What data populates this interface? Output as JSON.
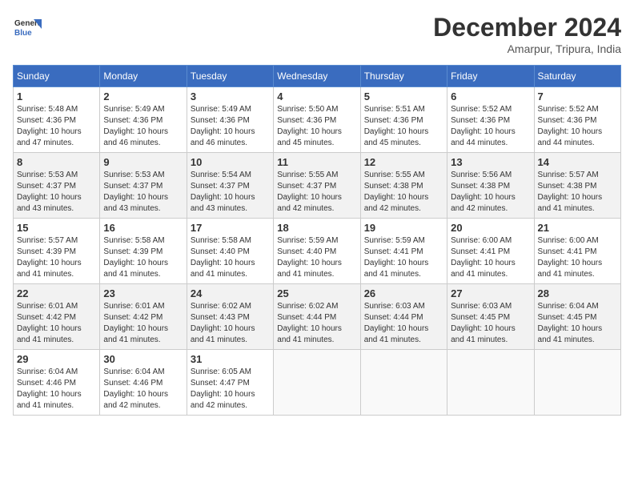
{
  "header": {
    "logo_line1": "General",
    "logo_line2": "Blue",
    "month": "December 2024",
    "location": "Amarpur, Tripura, India"
  },
  "days_of_week": [
    "Sunday",
    "Monday",
    "Tuesday",
    "Wednesday",
    "Thursday",
    "Friday",
    "Saturday"
  ],
  "weeks": [
    [
      {
        "day": "1",
        "sunrise": "5:48 AM",
        "sunset": "4:36 PM",
        "daylight": "10 hours and 47 minutes."
      },
      {
        "day": "2",
        "sunrise": "5:49 AM",
        "sunset": "4:36 PM",
        "daylight": "10 hours and 46 minutes."
      },
      {
        "day": "3",
        "sunrise": "5:49 AM",
        "sunset": "4:36 PM",
        "daylight": "10 hours and 46 minutes."
      },
      {
        "day": "4",
        "sunrise": "5:50 AM",
        "sunset": "4:36 PM",
        "daylight": "10 hours and 45 minutes."
      },
      {
        "day": "5",
        "sunrise": "5:51 AM",
        "sunset": "4:36 PM",
        "daylight": "10 hours and 45 minutes."
      },
      {
        "day": "6",
        "sunrise": "5:52 AM",
        "sunset": "4:36 PM",
        "daylight": "10 hours and 44 minutes."
      },
      {
        "day": "7",
        "sunrise": "5:52 AM",
        "sunset": "4:36 PM",
        "daylight": "10 hours and 44 minutes."
      }
    ],
    [
      {
        "day": "8",
        "sunrise": "5:53 AM",
        "sunset": "4:37 PM",
        "daylight": "10 hours and 43 minutes."
      },
      {
        "day": "9",
        "sunrise": "5:53 AM",
        "sunset": "4:37 PM",
        "daylight": "10 hours and 43 minutes."
      },
      {
        "day": "10",
        "sunrise": "5:54 AM",
        "sunset": "4:37 PM",
        "daylight": "10 hours and 43 minutes."
      },
      {
        "day": "11",
        "sunrise": "5:55 AM",
        "sunset": "4:37 PM",
        "daylight": "10 hours and 42 minutes."
      },
      {
        "day": "12",
        "sunrise": "5:55 AM",
        "sunset": "4:38 PM",
        "daylight": "10 hours and 42 minutes."
      },
      {
        "day": "13",
        "sunrise": "5:56 AM",
        "sunset": "4:38 PM",
        "daylight": "10 hours and 42 minutes."
      },
      {
        "day": "14",
        "sunrise": "5:57 AM",
        "sunset": "4:38 PM",
        "daylight": "10 hours and 41 minutes."
      }
    ],
    [
      {
        "day": "15",
        "sunrise": "5:57 AM",
        "sunset": "4:39 PM",
        "daylight": "10 hours and 41 minutes."
      },
      {
        "day": "16",
        "sunrise": "5:58 AM",
        "sunset": "4:39 PM",
        "daylight": "10 hours and 41 minutes."
      },
      {
        "day": "17",
        "sunrise": "5:58 AM",
        "sunset": "4:40 PM",
        "daylight": "10 hours and 41 minutes."
      },
      {
        "day": "18",
        "sunrise": "5:59 AM",
        "sunset": "4:40 PM",
        "daylight": "10 hours and 41 minutes."
      },
      {
        "day": "19",
        "sunrise": "5:59 AM",
        "sunset": "4:41 PM",
        "daylight": "10 hours and 41 minutes."
      },
      {
        "day": "20",
        "sunrise": "6:00 AM",
        "sunset": "4:41 PM",
        "daylight": "10 hours and 41 minutes."
      },
      {
        "day": "21",
        "sunrise": "6:00 AM",
        "sunset": "4:41 PM",
        "daylight": "10 hours and 41 minutes."
      }
    ],
    [
      {
        "day": "22",
        "sunrise": "6:01 AM",
        "sunset": "4:42 PM",
        "daylight": "10 hours and 41 minutes."
      },
      {
        "day": "23",
        "sunrise": "6:01 AM",
        "sunset": "4:42 PM",
        "daylight": "10 hours and 41 minutes."
      },
      {
        "day": "24",
        "sunrise": "6:02 AM",
        "sunset": "4:43 PM",
        "daylight": "10 hours and 41 minutes."
      },
      {
        "day": "25",
        "sunrise": "6:02 AM",
        "sunset": "4:44 PM",
        "daylight": "10 hours and 41 minutes."
      },
      {
        "day": "26",
        "sunrise": "6:03 AM",
        "sunset": "4:44 PM",
        "daylight": "10 hours and 41 minutes."
      },
      {
        "day": "27",
        "sunrise": "6:03 AM",
        "sunset": "4:45 PM",
        "daylight": "10 hours and 41 minutes."
      },
      {
        "day": "28",
        "sunrise": "6:04 AM",
        "sunset": "4:45 PM",
        "daylight": "10 hours and 41 minutes."
      }
    ],
    [
      {
        "day": "29",
        "sunrise": "6:04 AM",
        "sunset": "4:46 PM",
        "daylight": "10 hours and 41 minutes."
      },
      {
        "day": "30",
        "sunrise": "6:04 AM",
        "sunset": "4:46 PM",
        "daylight": "10 hours and 42 minutes."
      },
      {
        "day": "31",
        "sunrise": "6:05 AM",
        "sunset": "4:47 PM",
        "daylight": "10 hours and 42 minutes."
      },
      null,
      null,
      null,
      null
    ]
  ]
}
